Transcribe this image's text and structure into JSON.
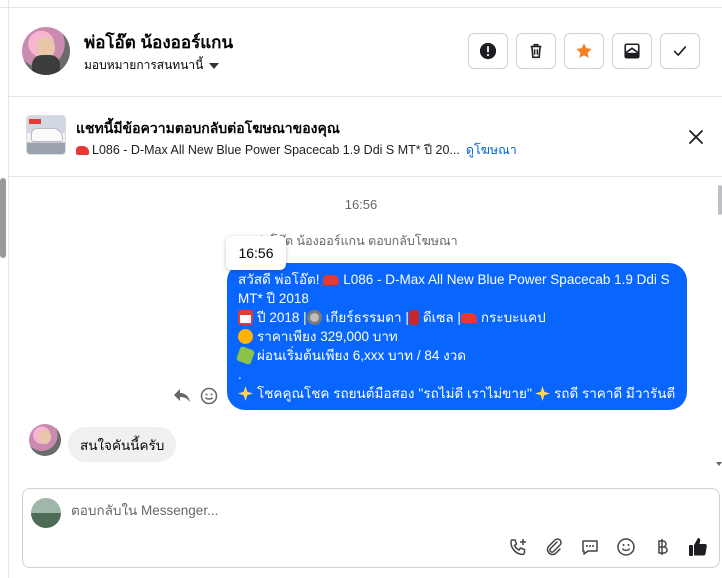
{
  "header": {
    "contact_name": "พ่อโอ๊ต น้องออร์แกน",
    "assign_label": "มอบหมายการสนทนานี้",
    "buttons": [
      {
        "name": "spam",
        "icon": "exclamation-icon"
      },
      {
        "name": "delete",
        "icon": "trash-icon"
      },
      {
        "name": "star",
        "icon": "star-icon",
        "color": "#f5821f"
      },
      {
        "name": "move-to-inbox",
        "icon": "inbox-icon"
      },
      {
        "name": "mark-done",
        "icon": "check-icon"
      }
    ]
  },
  "ad": {
    "title": "แชทนี้มีข้อความตอบกลับต่อโฆษณาของคุณ",
    "subtitle": "L086 - D-Max All New Blue Power Spacecab 1.9 Ddi S MT* ปี 20...",
    "link": "ดูโฆษณา"
  },
  "conversation": {
    "timestamp": "16:56",
    "reply_note": "พ่อโอ๊ต น้องออร์แกน ตอบกลับโฆษณา",
    "tooltip_time": "16:56",
    "outgoing": {
      "line1": "สวัสดี พ่อโอ๊ต! ",
      "line1b": "L086 - D-Max All New Blue Power Spacecab 1.9 Ddi S MT* ปี 2018",
      "line2": "ปี 2018 | ",
      "line2b": "เกียร์ธรรมดา | ",
      "line2c": "ดีเซล | ",
      "line2d": "กระบะแคป",
      "line3": "ราคาเพียง 329,000 บาท",
      "line4": "ผ่อนเริ่มต้นเพียง 6,xxx บาท / 84 งวด",
      "line5": ".",
      "line6a": "โชคคูณโชค รถยนต์มือสอง ''รถไม่ดี เราไม่ขาย''",
      "line6b": " รถดี ราคาดี มีวารันตี"
    },
    "incoming": {
      "text": "สนใจคันนี้ครับ"
    }
  },
  "composer": {
    "placeholder": "ตอบกลับใน Messenger..."
  },
  "colors": {
    "accent": "#0866ff",
    "star": "#f5821f",
    "link": "#0064d1"
  }
}
